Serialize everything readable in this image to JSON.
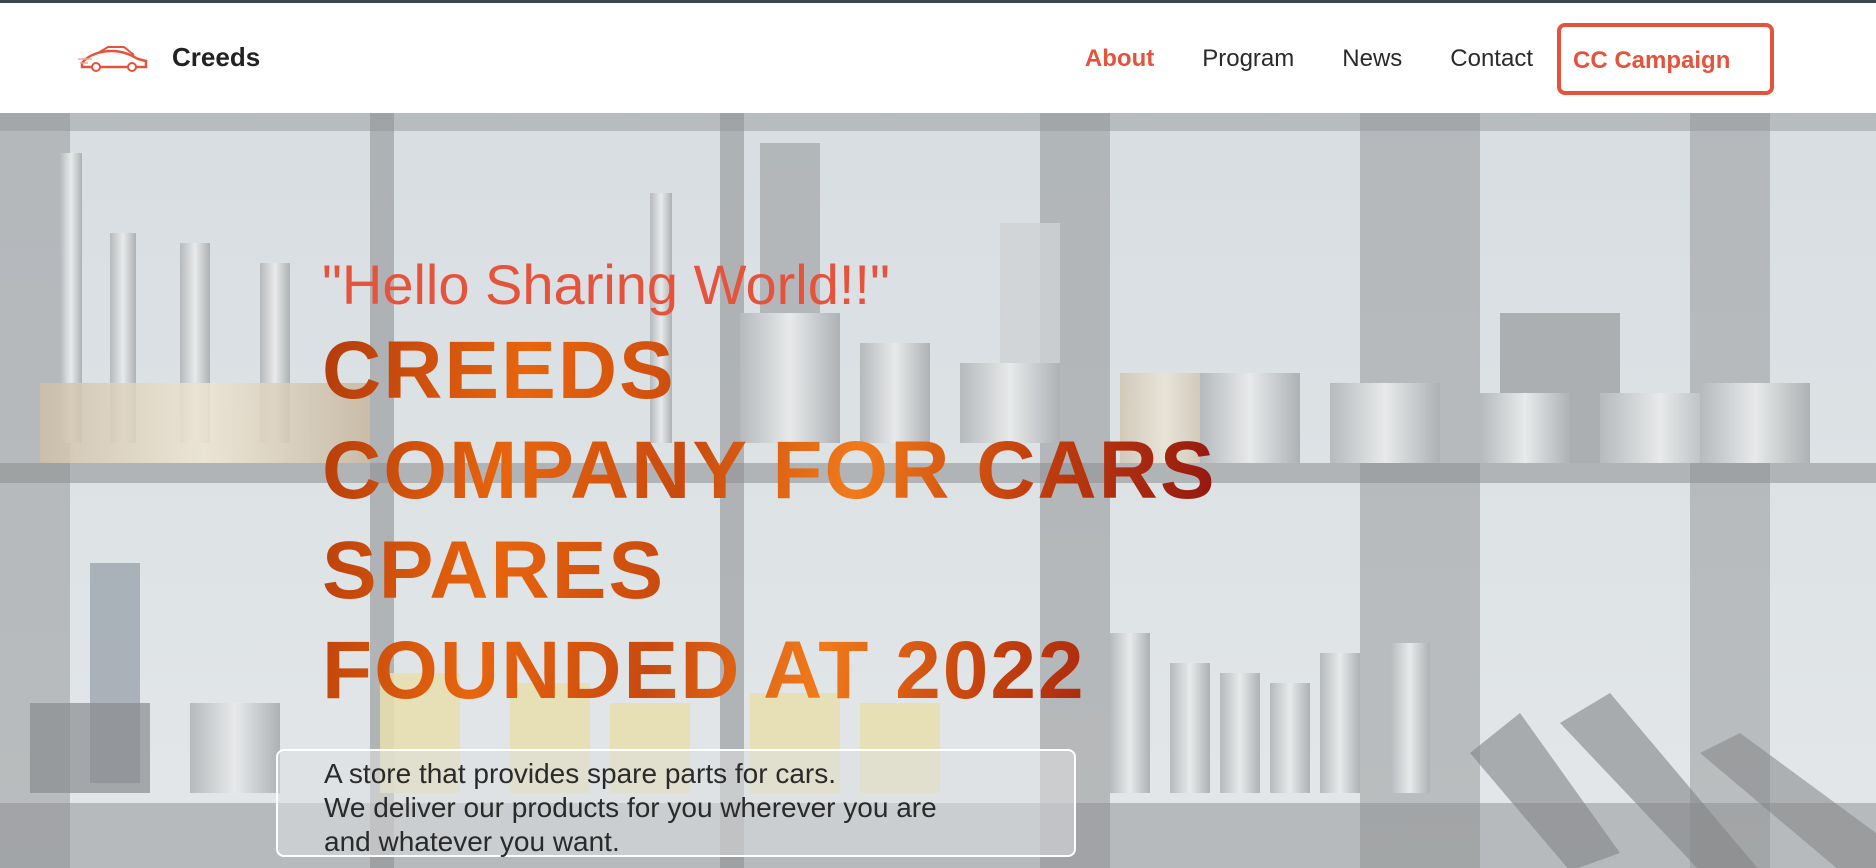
{
  "header": {
    "brand_name": "Creeds",
    "brand_logo_icon": "car-logo-icon",
    "nav_links": [
      "About",
      "Program",
      "News",
      "Contact"
    ],
    "active_link": "About",
    "cta_label": "CC Campaign"
  },
  "hero": {
    "tagline": "\"Hello Sharing World!!\"",
    "headline_lines": [
      "CREEDS",
      "COMPANY FOR CARS",
      "SPARES",
      "FOUNDED AT 2022"
    ],
    "description_lines": [
      "A store that provides spare parts for cars.",
      "We deliver our products for you wherever you are",
      "and whatever you want."
    ]
  },
  "colors": {
    "accent": "#e5533d",
    "headline_orange": "#e8650d",
    "headline_dark_red": "#8a1010",
    "text_dark": "#222222"
  }
}
